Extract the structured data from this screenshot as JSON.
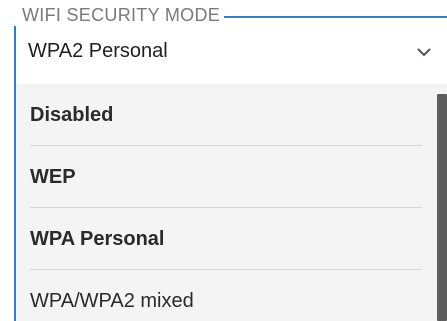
{
  "field": {
    "legend": "WIFI SECURITY MODE",
    "selected_value": "WPA2 Personal"
  },
  "menu": {
    "items": [
      {
        "label": "Disabled"
      },
      {
        "label": "WEP"
      },
      {
        "label": "WPA Personal"
      },
      {
        "label": "WPA/WPA2 mixed"
      }
    ]
  },
  "colors": {
    "accent": "#2f7fc1",
    "menu_background": "#f4f4f4",
    "scrollbar": "#5d5d5d"
  },
  "icons": {
    "dropdown": "chevron-down-icon"
  }
}
